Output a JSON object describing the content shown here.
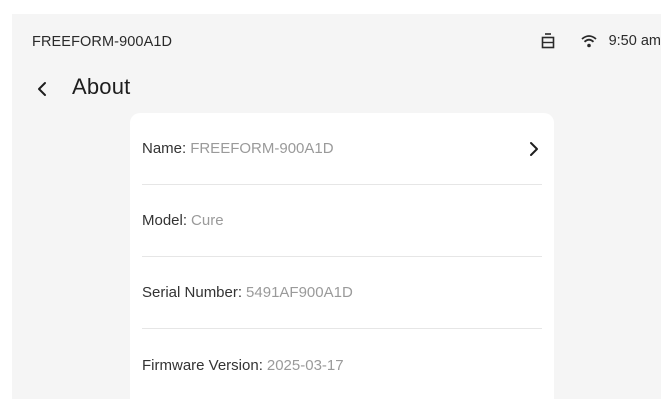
{
  "status_bar": {
    "device_name": "FREEFORM-900A1D",
    "time": "9:50 am",
    "icons": [
      "battery-icon",
      "wifi-icon"
    ]
  },
  "header": {
    "back_icon": "chevron-left-icon",
    "title": "About"
  },
  "info": {
    "name": {
      "label": "Name:",
      "value": "FREEFORM-900A1D",
      "icon": "chevron-right-icon"
    },
    "model": {
      "label": "Model:",
      "value": "Cure"
    },
    "serial": {
      "label": "Serial Number:",
      "value": "5491AF900A1D"
    },
    "firmware": {
      "label": "Firmware Version:",
      "value": "2025-03-17"
    }
  },
  "colors": {
    "screen_background": "#f5f5f5",
    "card_background": "#ffffff",
    "label_text": "#333333",
    "value_text": "#9a9a9a",
    "divider": "#e6e6e6"
  }
}
